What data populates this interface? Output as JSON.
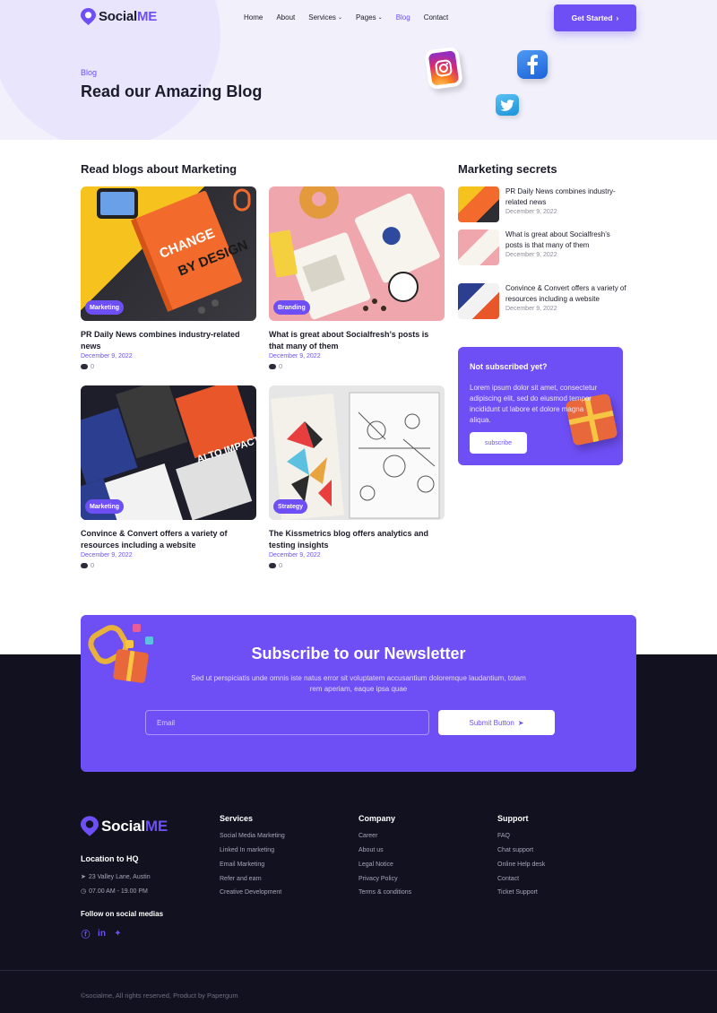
{
  "brand": {
    "name_part1": "Social",
    "name_part2": "ME",
    "accent": "#6e4ff6"
  },
  "nav": {
    "items": [
      {
        "label": "Home"
      },
      {
        "label": "About"
      },
      {
        "label": "Services",
        "has_dropdown": true
      },
      {
        "label": "Pages",
        "has_dropdown": true
      },
      {
        "label": "Blog",
        "active": true
      },
      {
        "label": "Contact"
      }
    ],
    "cta_label": "Get Started",
    "cta_icon": "chevron-right-icon"
  },
  "hero": {
    "kicker": "Blog",
    "title": "Read our Amazing Blog",
    "social_icons": [
      "instagram-icon",
      "facebook-icon",
      "twitter-icon"
    ]
  },
  "blog": {
    "section_title": "Read blogs about Marketing",
    "posts": [
      {
        "tag": "Marketing",
        "title": "PR Daily News combines industry-related news",
        "date": "December 9, 2022",
        "comments": "0"
      },
      {
        "tag": "Branding",
        "title": "What is great about Socialfresh’s posts is that many of them",
        "date": "December 9, 2022",
        "comments": "0"
      },
      {
        "tag": "Marketing",
        "title": "Convince & Convert offers a variety of resources including a website",
        "date": "December 9, 2022",
        "comments": "0"
      },
      {
        "tag": "Strategy",
        "title": "The Kissmetrics blog offers analytics and testing insights",
        "date": "December 9, 2022",
        "comments": "0"
      }
    ]
  },
  "sidebar": {
    "title": "Marketing secrets",
    "items": [
      {
        "title": "PR Daily News combines industry-related news",
        "date": "December 9, 2022"
      },
      {
        "title": "What is great about Socialfresh’s posts is that many of them",
        "date": "December 9, 2022"
      },
      {
        "title": "Convince & Convert offers a variety of resources including a website",
        "date": "December 9, 2022"
      }
    ],
    "promo": {
      "title": "Not subscribed yet?",
      "text": "Lorem ipsum dolor sit amet, consectetur adipiscing elit, sed do eiusmod tempor incididunt ut labore et dolore magna aliqua.",
      "button": "subscribe"
    }
  },
  "newsletter": {
    "title": "Subscribe to our Newsletter",
    "text": "Sed ut perspiciatis unde omnis iste natus error sit voluptatem accusantium doloremque laudantium, totam rem aperiam, eaque ipsa quae",
    "email_placeholder": "Email",
    "button": "Submit Button"
  },
  "footer": {
    "location_title": "Location to HQ",
    "address": "23 Valley Lane, Austin",
    "hours": "07.00 AM - 19.00 PM",
    "follow_title": "Follow on social medias",
    "columns": [
      {
        "title": "Services",
        "links": [
          "Social Media Marketing",
          "Linked In marketing",
          "Email Marketing",
          "Refer and earn",
          "Creative Development"
        ]
      },
      {
        "title": "Company",
        "links": [
          "Career",
          "About us",
          "Legal Notice",
          "Privacy Policy",
          "Terms & conditions"
        ]
      },
      {
        "title": "Support",
        "links": [
          "FAQ",
          "Chat support",
          "Online Help desk",
          "Contact",
          "Ticket Support"
        ]
      }
    ],
    "copyright": "©socialme, All rights reserved, Product by Papergum"
  }
}
